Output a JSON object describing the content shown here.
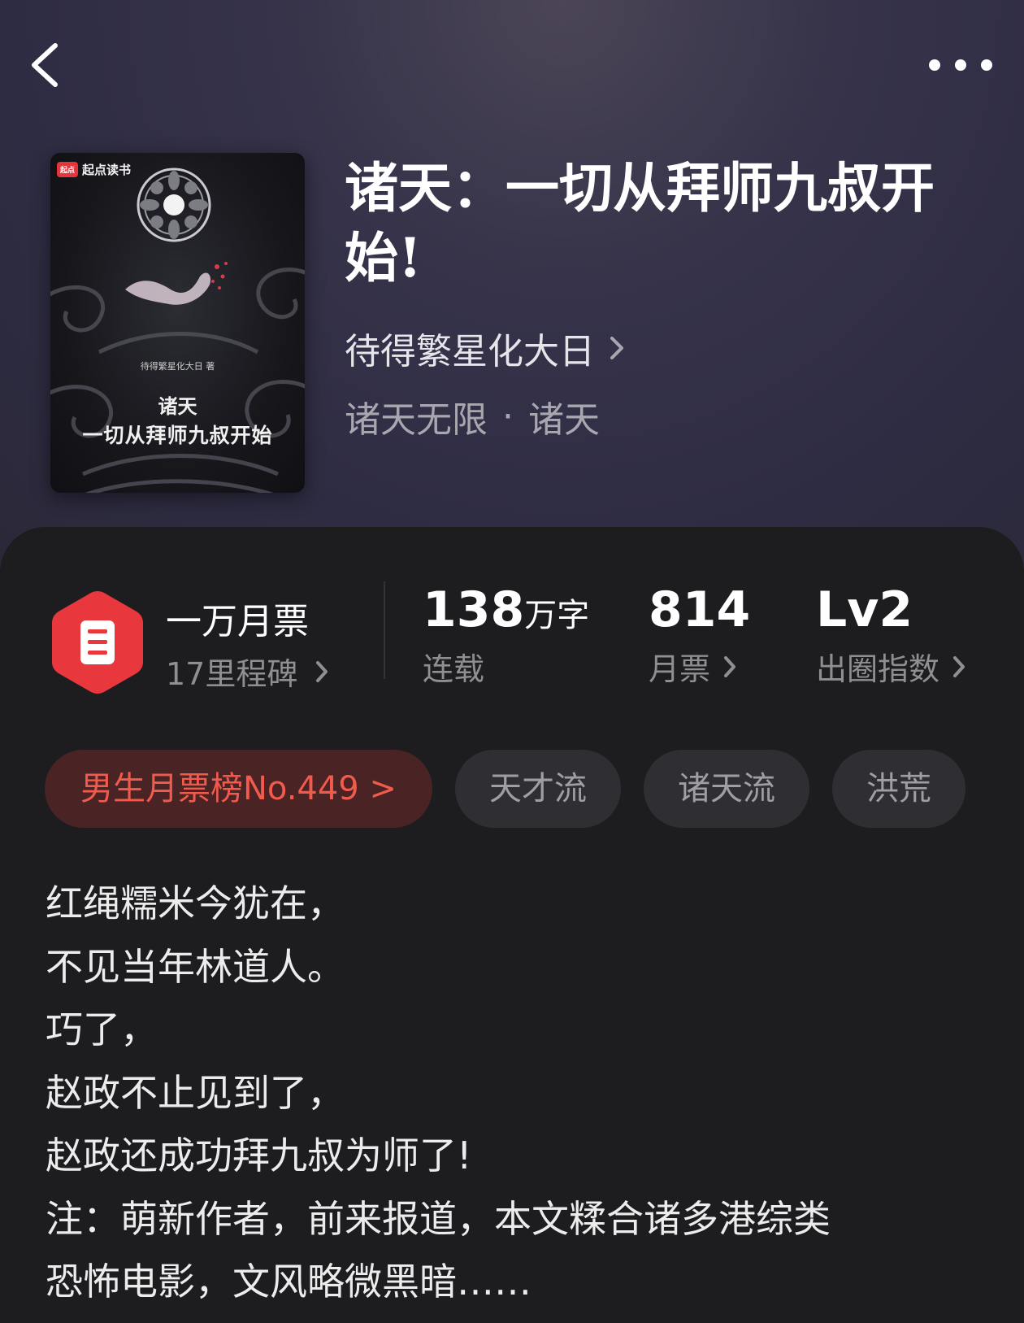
{
  "nav": {
    "back_icon": "chevron-left-icon",
    "more_icon": "more-dots-icon"
  },
  "book": {
    "cover": {
      "brand": "起点读书",
      "brand_logo": "起点",
      "byline": "待得繁星化大日 著",
      "title_line1": "诸天",
      "title_line2": "一切从拜师九叔开始"
    },
    "title": "诸天：一切从拜师九叔开始!",
    "author": "待得繁星化大日",
    "genre": [
      "诸天无限",
      "诸天"
    ],
    "genre_separator": "·"
  },
  "stats": {
    "ticket_title": "一万月票",
    "milestone": "17里程碑",
    "word_count_value": "138",
    "word_count_unit": "万字",
    "status": "连载",
    "monthly_tickets_value": "814",
    "monthly_tickets_label": "月票",
    "level_value": "Lv2",
    "level_label": "出圈指数"
  },
  "tags": [
    "男生月票榜No.449 >",
    "天才流",
    "诸天流",
    "洪荒"
  ],
  "intro": [
    "红绳糯米今犹在，",
    "不见当年林道人。",
    "巧了，",
    "赵政不止见到了，",
    "赵政还成功拜九叔为师了!",
    "注：萌新作者，前来报道，本文糅合诸多港综类",
    "恐怖电影，文风略微黑暗……"
  ],
  "colors": {
    "accent_red": "#e8383d",
    "rank_text": "#f15a4d",
    "rank_bg": "#4a2324"
  }
}
